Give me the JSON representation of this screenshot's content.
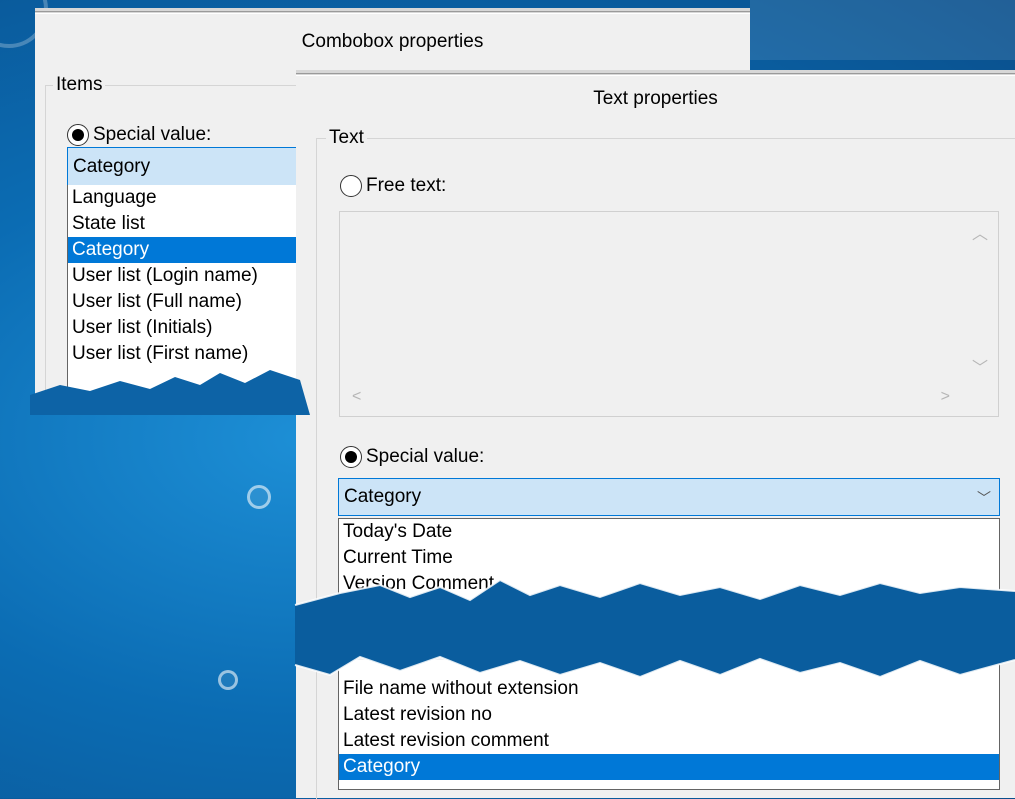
{
  "combobox_dialog": {
    "title": "Combobox properties",
    "group_label": "Items",
    "radio_label": "Special value:",
    "combo_value": "Category",
    "list_items": [
      "Language",
      "State list",
      "Category",
      "User list (Login name)",
      "User list (Full name)",
      "User list (Initials)",
      "User list (First name)"
    ],
    "selected_index": 2
  },
  "text_dialog": {
    "title": "Text properties",
    "group_label": "Text",
    "free_text_label": "Free text:",
    "special_value_label": "Special value:",
    "combo_value": "Category",
    "list_top_items": [
      "Today's Date",
      "Current Time",
      "Version Comment"
    ],
    "list_bottom_items": [
      "File name without extension",
      "Latest revision no",
      "Latest revision comment",
      "Category"
    ],
    "selected_bottom_index": 3
  },
  "icons": {
    "chevron": "chevron-down-icon",
    "scroll_up": "scroll-up-icon",
    "scroll_down": "scroll-down-icon",
    "scroll_left": "scroll-left-icon",
    "scroll_right": "scroll-right-icon"
  },
  "colors": {
    "selection": "#0078d7",
    "combo_fill": "#cce4f7",
    "dialog_bg": "#f0f0f0",
    "background": "#0b6cb3"
  }
}
